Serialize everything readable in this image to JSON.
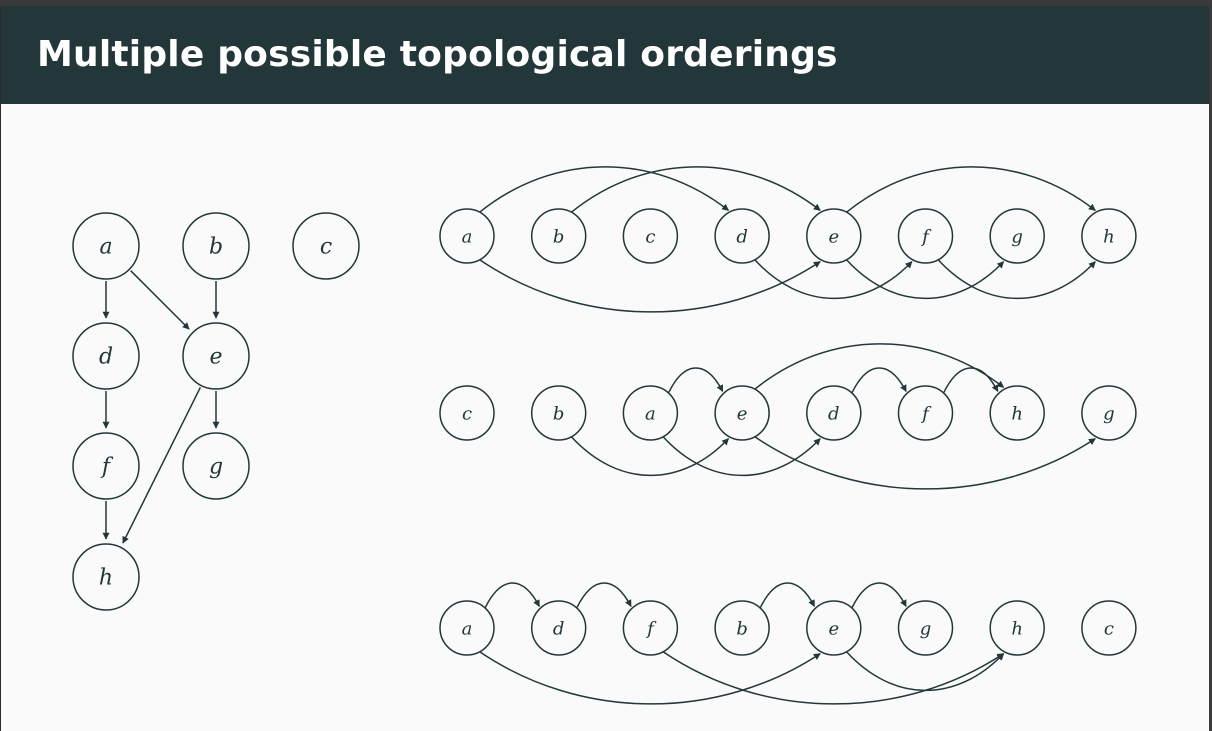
{
  "slide": {
    "title": "Multiple possible topological orderings"
  },
  "colors": {
    "title_background": "#23373b",
    "slide_background": "#fafafa",
    "ink": "#23373b"
  },
  "graph": {
    "nodes": [
      "a",
      "b",
      "c",
      "d",
      "e",
      "f",
      "g",
      "h"
    ],
    "edges": [
      [
        "a",
        "d"
      ],
      [
        "a",
        "e"
      ],
      [
        "b",
        "e"
      ],
      [
        "d",
        "f"
      ],
      [
        "e",
        "g"
      ],
      [
        "e",
        "h"
      ],
      [
        "f",
        "h"
      ]
    ]
  },
  "orderings": [
    [
      "a",
      "b",
      "c",
      "d",
      "e",
      "f",
      "g",
      "h"
    ],
    [
      "c",
      "b",
      "a",
      "e",
      "d",
      "f",
      "h",
      "g"
    ],
    [
      "a",
      "d",
      "f",
      "b",
      "e",
      "g",
      "h",
      "c"
    ]
  ]
}
